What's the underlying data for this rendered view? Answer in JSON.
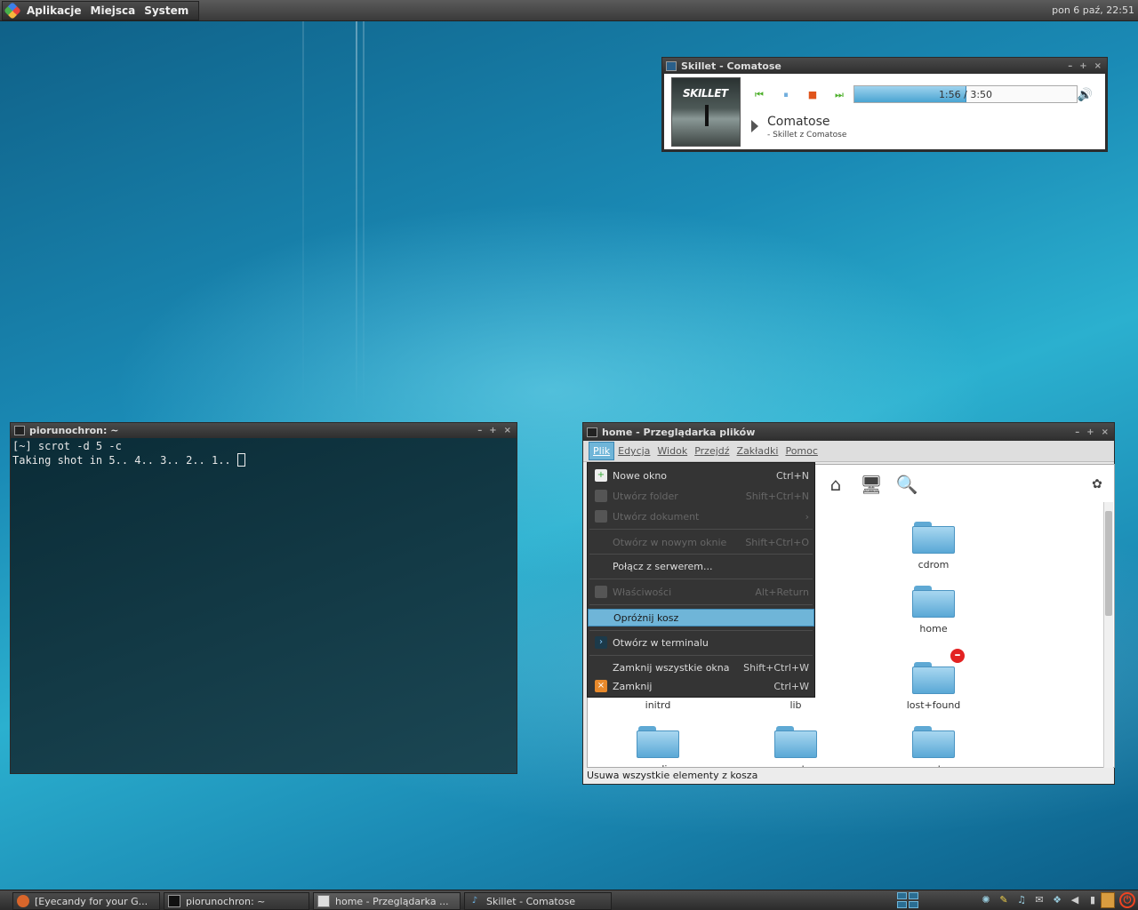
{
  "top_panel": {
    "menus": [
      "Aplikacje",
      "Miejsca",
      "System"
    ],
    "clock": "pon  6 paź, 22:51"
  },
  "player": {
    "window_title": "Skillet - Comatose",
    "album_art_text": "SKILLET",
    "elapsed": "1:56",
    "total": "3:50",
    "progress_text": "1:56 / 3:50",
    "progress_fraction": 0.504,
    "track_title": "Comatose",
    "track_subtitle": "- Skillet z Comatose",
    "controls": [
      "previous-icon",
      "pause-icon",
      "stop-icon",
      "next-icon"
    ],
    "colors": {
      "prev_next": "#4caf2a",
      "pause": "#3a8fd0",
      "stop": "#e0541b"
    }
  },
  "terminal": {
    "window_title": "piorunochron: ~",
    "lines": [
      "[~] scrot -d 5 -c",
      "Taking shot in 5.. 4.. 3.. 2.. 1.. "
    ]
  },
  "file_manager": {
    "window_title": "home - Przeglądarka plików",
    "menus": [
      "Plik",
      "Edycja",
      "Widok",
      "Przejdź",
      "Zakładki",
      "Pomoc"
    ],
    "folders": [
      {
        "name": "cdrom"
      },
      {
        "name": "home"
      },
      {
        "name": "lost+found",
        "badge": "no-entry"
      },
      {
        "name": "initrd"
      },
      {
        "name": "lib"
      },
      {
        "name": "media"
      },
      {
        "name": "mnt"
      },
      {
        "name": "opt"
      }
    ],
    "status": "Usuwa wszystkie elementy z kosza"
  },
  "dropdown": {
    "items": [
      {
        "label": "Nowe okno",
        "shortcut": "Ctrl+N",
        "disabled": false
      },
      {
        "label": "Utwórz folder",
        "shortcut": "Shift+Ctrl+N",
        "disabled": true
      },
      {
        "label": "Utwórz dokument",
        "shortcut": "›",
        "disabled": true
      },
      {
        "label": "Otwórz w nowym oknie",
        "shortcut": "Shift+Ctrl+O",
        "disabled": true
      },
      {
        "label": "Połącz z serwerem...",
        "shortcut": "",
        "disabled": false
      },
      {
        "label": "Właściwości",
        "shortcut": "Alt+Return",
        "disabled": true
      },
      {
        "label": "Opróżnij kosz",
        "shortcut": "",
        "disabled": false,
        "selected": true
      },
      {
        "label": "Otwórz w terminalu",
        "shortcut": "",
        "disabled": false
      },
      {
        "label": "Zamknij wszystkie okna",
        "shortcut": "Shift+Ctrl+W",
        "disabled": false
      },
      {
        "label": "Zamknij",
        "shortcut": "Ctrl+W",
        "disabled": false
      }
    ]
  },
  "taskbar": {
    "tasks": [
      {
        "label": "[Eyecandy for your G...",
        "icon": "firefox-icon"
      },
      {
        "label": "piorunochron: ~",
        "icon": "terminal-icon"
      },
      {
        "label": "home - Przeglądarka ...",
        "icon": "file-manager-icon"
      },
      {
        "label": "Skillet - Comatose",
        "icon": "music-note-icon"
      }
    ]
  }
}
